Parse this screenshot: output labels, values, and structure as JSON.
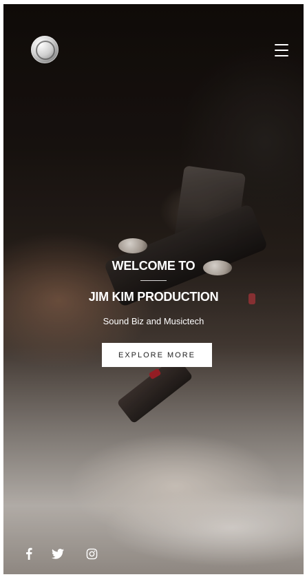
{
  "hero": {
    "welcome": "WELCOME TO",
    "name": "JIM KIM PRODUCTION",
    "tagline": "Sound Biz and Musictech",
    "cta_label": "EXPLORE MORE"
  },
  "icons": {
    "logo": "record-logo",
    "menu": "hamburger-menu-icon",
    "social": [
      "facebook-icon",
      "twitter-icon",
      "instagram-icon"
    ]
  },
  "colors": {
    "text": "#ffffff",
    "button_bg": "#ffffff",
    "button_text": "#1f1f1f"
  }
}
